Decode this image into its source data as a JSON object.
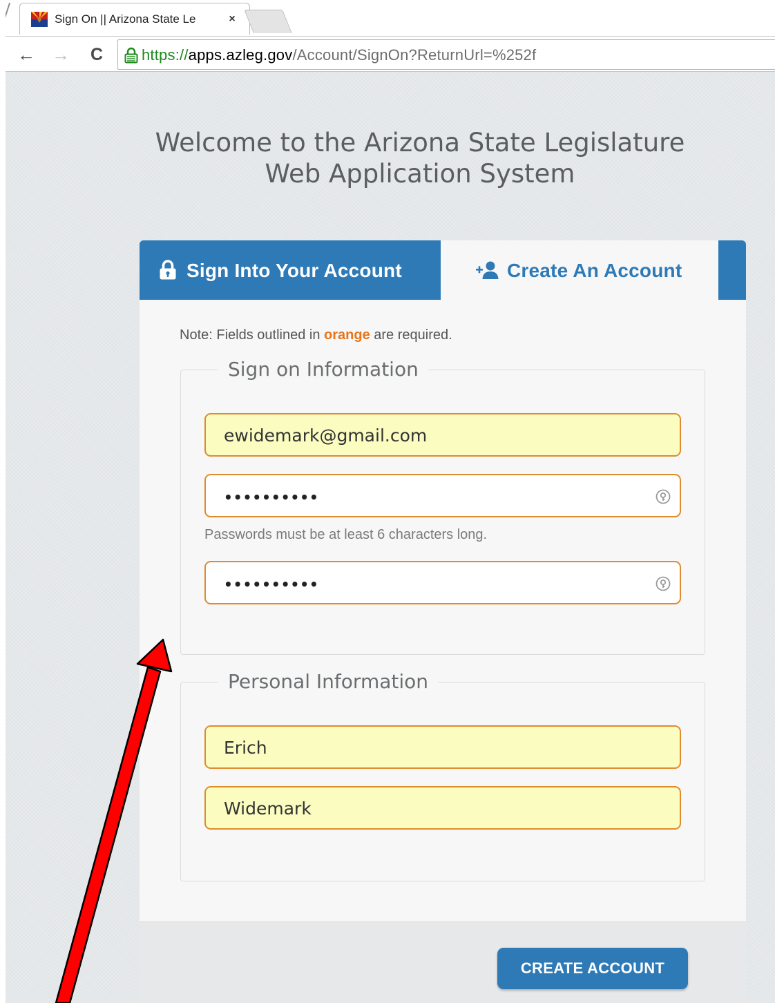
{
  "browser": {
    "tab_title": "Sign On || Arizona State Le",
    "tab_close": "×",
    "nav": {
      "back": "←",
      "forward": "→",
      "reload": "C"
    },
    "url": {
      "scheme": "https://",
      "host": "apps.azleg.gov",
      "path": "/Account/SignOn?ReturnUrl=%252f"
    }
  },
  "page": {
    "welcome_line1": "Welcome to the Arizona State Legislature",
    "welcome_line2": "Web Application System",
    "tabs": {
      "signin_label": "Sign Into Your Account",
      "create_label": "Create An Account",
      "active": "Create An Account"
    },
    "note": {
      "prefix": "Note: Fields outlined in ",
      "highlight": "orange",
      "suffix": " are required."
    },
    "signon_section": {
      "legend": "Sign on Information",
      "email_value": "ewidemark@gmail.com",
      "password_value": "••••••••••",
      "password_hint": "Passwords must be at least 6 characters long.",
      "confirm_value": "••••••••••"
    },
    "personal_section": {
      "legend": "Personal Information",
      "first_name_value": "Erich",
      "last_name_value": "Widemark"
    },
    "create_button": "CREATE ACCOUNT"
  },
  "colors": {
    "brand_blue": "#2e7ab7",
    "required_orange": "#e08b2d",
    "autofill_yellow": "#fafcc0",
    "annotation_red": "#ff0000"
  },
  "icons": [
    "arizona-flag-icon",
    "close-icon",
    "back-arrow-icon",
    "forward-arrow-icon",
    "reload-icon",
    "lock-icon",
    "padlock-icon",
    "add-user-icon",
    "password-key-icon"
  ]
}
